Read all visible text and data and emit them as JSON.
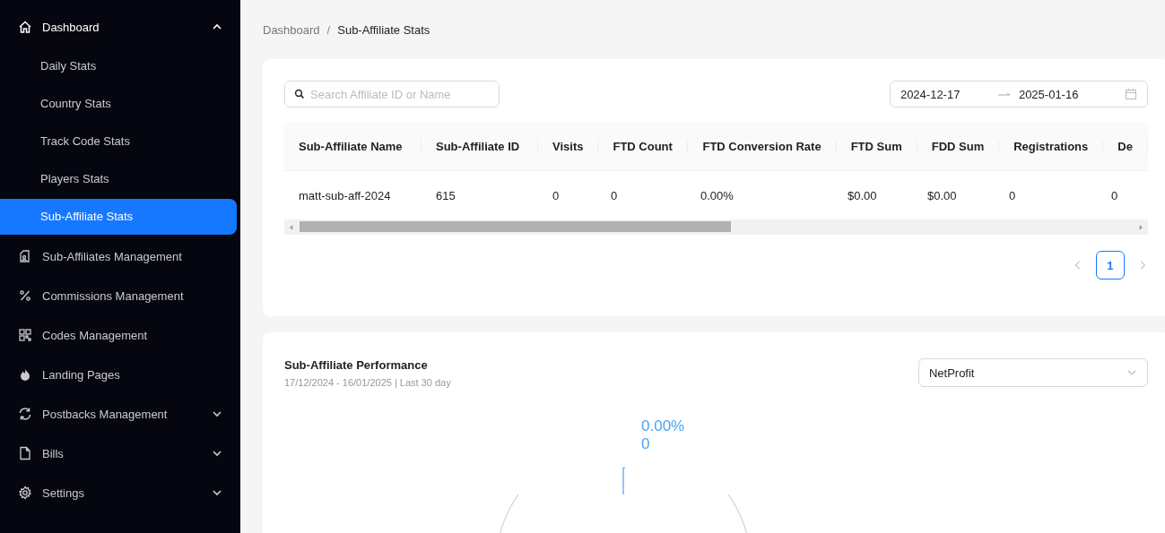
{
  "sidebar": {
    "items": [
      {
        "label": "Dashboard",
        "expanded": true,
        "children": [
          {
            "label": "Daily Stats",
            "selected": false
          },
          {
            "label": "Country Stats",
            "selected": false
          },
          {
            "label": "Track Code Stats",
            "selected": false
          },
          {
            "label": "Players Stats",
            "selected": false
          },
          {
            "label": "Sub-Affiliate Stats",
            "selected": true
          }
        ]
      },
      {
        "label": "Sub-Affiliates Management"
      },
      {
        "label": "Commissions Management"
      },
      {
        "label": "Codes Management"
      },
      {
        "label": "Landing Pages"
      },
      {
        "label": "Postbacks Management",
        "expanded": false
      },
      {
        "label": "Bills",
        "expanded": false
      },
      {
        "label": "Settings",
        "expanded": false
      }
    ]
  },
  "breadcrumb": {
    "separator": "/",
    "items": [
      "Dashboard",
      "Sub-Affiliate Stats"
    ]
  },
  "stats_card": {
    "search": {
      "placeholder": "Search Affiliate ID or Name"
    },
    "date_range": {
      "start": "2024-12-17",
      "end": "2025-01-16"
    },
    "table": {
      "columns": [
        "Sub-Affiliate Name",
        "Sub-Affiliate ID",
        "Visits",
        "FTD Count",
        "FTD Conversion Rate",
        "FTD Sum",
        "FDD Sum",
        "Registrations",
        "De"
      ],
      "rows": [
        [
          "matt-sub-aff-2024",
          "615",
          "0",
          "0",
          "0.00%",
          "$0.00",
          "$0.00",
          "0",
          "0"
        ]
      ]
    },
    "pagination": {
      "pages": [
        {
          "label": "1",
          "selected": true
        }
      ]
    }
  },
  "performance_card": {
    "title": "Sub-Affiliate Performance",
    "subtitle": "17/12/2024 - 16/01/2025 | Last 30 day",
    "metric_select": {
      "value": "NetProfit"
    },
    "pie_label": {
      "percent": "0.00%",
      "value": "0"
    }
  }
}
